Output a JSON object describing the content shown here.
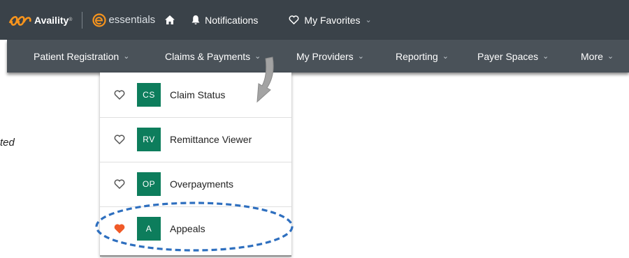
{
  "topbar": {
    "brand": "Availity",
    "brand_tm": "®",
    "essentials": "essentials",
    "notifications": "Notifications",
    "favorites": "My Favorites",
    "chevron": "⌄"
  },
  "nav": {
    "items": [
      {
        "label": "Patient Registration",
        "chevron": "⌄"
      },
      {
        "label": "Claims & Payments",
        "chevron": "⌄"
      },
      {
        "label": "My Providers",
        "chevron": "⌄"
      },
      {
        "label": "Reporting",
        "chevron": "⌄"
      },
      {
        "label": "Payer Spaces",
        "chevron": "⌄"
      },
      {
        "label": "More",
        "chevron": "⌄"
      }
    ]
  },
  "dropdown": {
    "items": [
      {
        "badge": "CS",
        "label": "Claim Status",
        "favorited": false
      },
      {
        "badge": "RV",
        "label": "Remittance Viewer",
        "favorited": false
      },
      {
        "badge": "OP",
        "label": "Overpayments",
        "favorited": false
      },
      {
        "badge": "A",
        "label": "Appeals",
        "favorited": true
      }
    ]
  },
  "side_note": "ted",
  "colors": {
    "topbar": "#3a4249",
    "navbar": "#4a5259",
    "badge": "#0d7d5c",
    "heart_active": "#f05a28",
    "heart_outline": "#555555",
    "highlight_ellipse": "#2e6fbf",
    "brand_orange": "#f7941d"
  },
  "icons": {
    "brand": "availity-logo-icon",
    "essentials": "essentials-logo-icon",
    "home": "home-icon",
    "notifications": "bell-icon",
    "favorites": "heart-outline-icon",
    "favorite_active": "heart-filled-icon",
    "annotation_arrow": "arrow-down-icon"
  }
}
